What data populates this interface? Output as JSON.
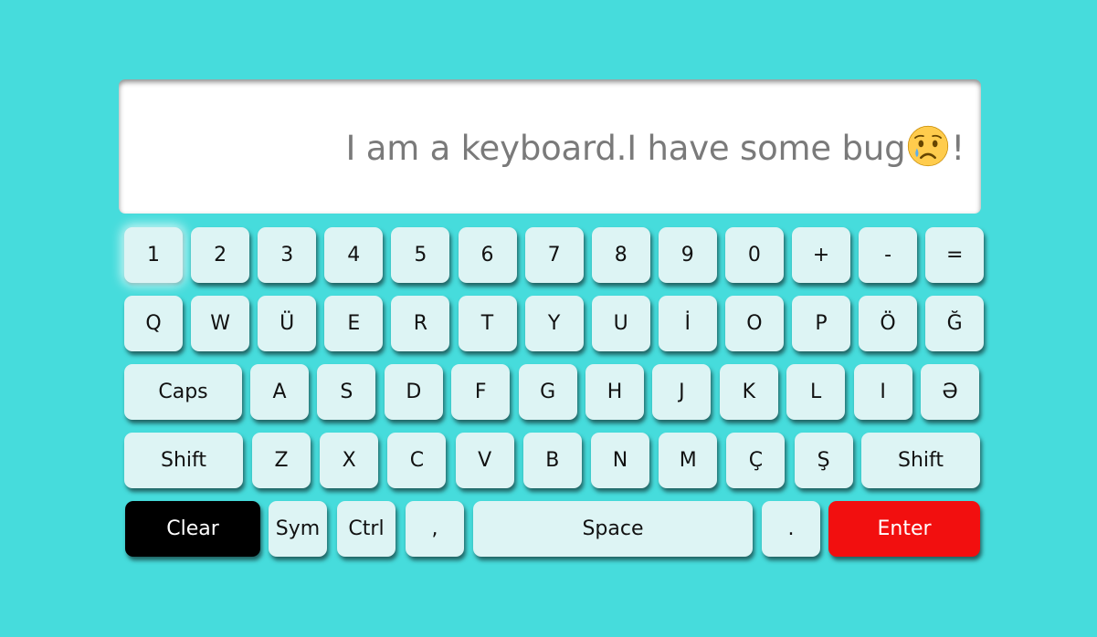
{
  "display": {
    "text_before": "I am a keyboard.I have some bug",
    "emoji": "crying-face",
    "text_after": "!"
  },
  "keyboard": {
    "row1": [
      "1",
      "2",
      "3",
      "4",
      "5",
      "6",
      "7",
      "8",
      "9",
      "0",
      "+",
      "-",
      "="
    ],
    "row2": [
      "Q",
      "W",
      "Ü",
      "E",
      "R",
      "T",
      "Y",
      "U",
      "İ",
      "O",
      "P",
      "Ö",
      "Ğ"
    ],
    "row3": [
      "Caps",
      "A",
      "S",
      "D",
      "F",
      "G",
      "H",
      "J",
      "K",
      "L",
      "I",
      "Ə"
    ],
    "row4": [
      "Shift",
      "Z",
      "X",
      "C",
      "V",
      "B",
      "N",
      "M",
      "Ç",
      "Ş",
      "Shift"
    ],
    "row5": [
      "Clear",
      "Sym",
      "Ctrl",
      ",",
      "Space",
      ".",
      "Enter"
    ]
  },
  "colors": {
    "background": "#46dcdc",
    "key": "#ddf4f4",
    "clear_key": "#000000",
    "enter_key": "#f20f0f"
  }
}
